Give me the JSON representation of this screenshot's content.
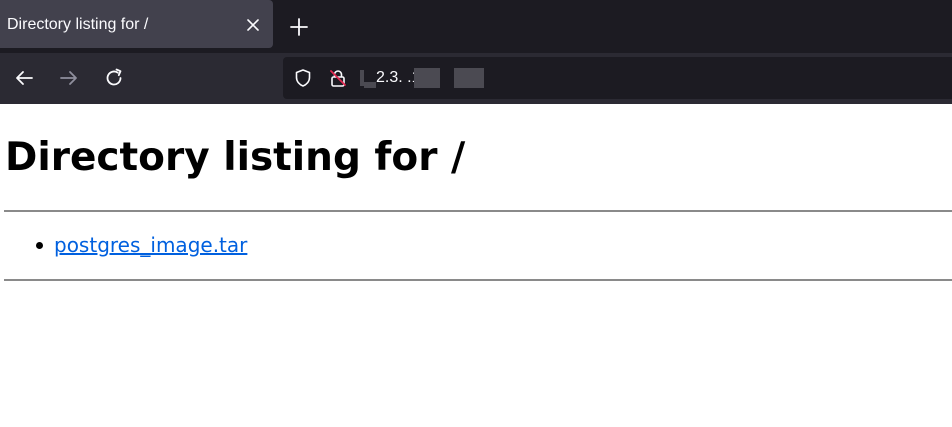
{
  "browser": {
    "tab": {
      "title": "Directory listing for /",
      "close_icon": "close-icon"
    },
    "new_tab_icon": "plus-icon",
    "nav": {
      "back_icon": "arrow-left-icon",
      "forward_icon": "arrow-right-icon",
      "reload_icon": "reload-icon"
    },
    "urlbar": {
      "shield_icon": "shield-icon",
      "lock_icon": "insecure-lock-icon",
      "url_visible_text": "2.3.     .1"
    },
    "colors": {
      "tabstrip_bg": "#1c1b22",
      "tab_bg": "#42414d",
      "navbar_bg": "#2b2a33",
      "urlbar_bg": "#1c1b22",
      "link": "#0060df"
    }
  },
  "page": {
    "heading": "Directory listing for /",
    "files": [
      {
        "name": "postgres_image.tar"
      }
    ]
  }
}
